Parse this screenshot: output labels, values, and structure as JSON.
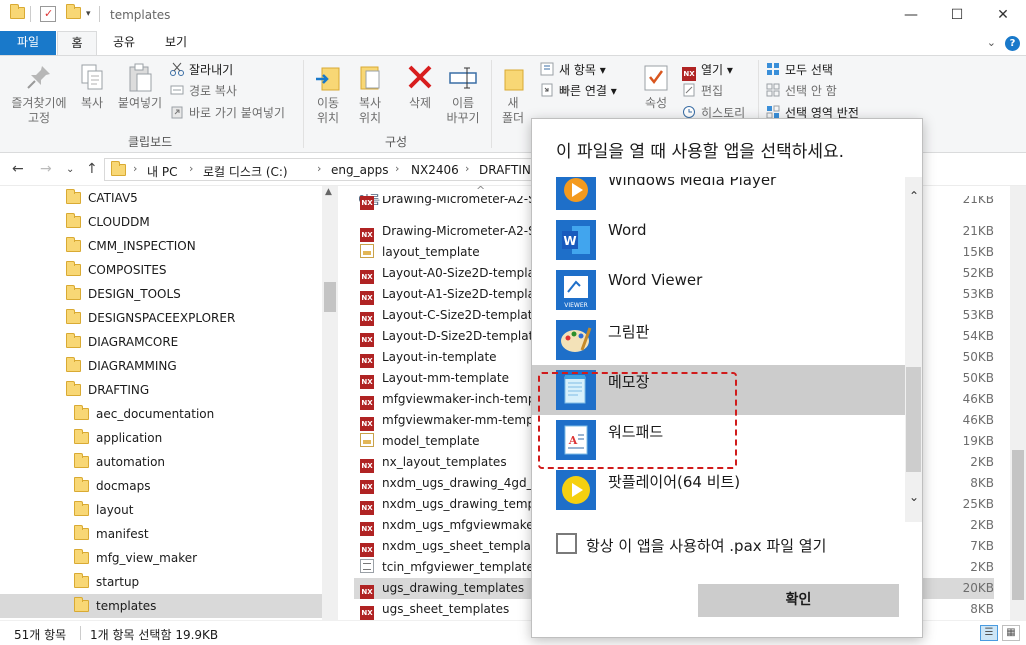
{
  "window": {
    "title": "templates",
    "minimize": "—",
    "maximize": "☐",
    "close": "✕",
    "accent": "#1979ca"
  },
  "tabs": {
    "file": "파일",
    "home": "홈",
    "share": "공유",
    "view": "보기",
    "help": "?"
  },
  "ribbon": {
    "clipboard": {
      "pin": "즐겨찾기에\n고정",
      "copy": "복사",
      "paste": "붙여넣기",
      "cut": "잘라내기",
      "copy_path": "경로 복사",
      "paste_shortcut": "바로 가기 붙여넣기",
      "group": "클립보드"
    },
    "organize": {
      "move_to": "이동\n위치",
      "copy_to": "복사\n위치",
      "delete": "삭제",
      "rename": "이름\n바꾸기",
      "group": "구성"
    },
    "new": {
      "new_folder": "새\n폴더",
      "new_item": "새 항목",
      "easy_access": "빠른 연결"
    },
    "open": {
      "properties": "속성",
      "open": "열기",
      "edit": "편집",
      "history": "히스토리"
    },
    "select": {
      "select_all": "모두 선택",
      "select_none": "선택 안 함",
      "invert": "선택 영역 반전"
    }
  },
  "address": {
    "crumbs": [
      "내 PC",
      "로컬 디스크 (C:)",
      "eng_apps",
      "NX2406",
      "DRAFTING"
    ]
  },
  "nav": {
    "items": [
      {
        "label": "CATIAV5",
        "indent": 0
      },
      {
        "label": "CLOUDDM",
        "indent": 0
      },
      {
        "label": "CMM_INSPECTION",
        "indent": 0
      },
      {
        "label": "COMPOSITES",
        "indent": 0
      },
      {
        "label": "DESIGN_TOOLS",
        "indent": 0
      },
      {
        "label": "DESIGNSPACEEXPLORER",
        "indent": 0
      },
      {
        "label": "DIAGRAMCORE",
        "indent": 0
      },
      {
        "label": "DIAGRAMMING",
        "indent": 0
      },
      {
        "label": "DRAFTING",
        "indent": 0
      },
      {
        "label": "aec_documentation",
        "indent": 1
      },
      {
        "label": "application",
        "indent": 1
      },
      {
        "label": "automation",
        "indent": 1
      },
      {
        "label": "docmaps",
        "indent": 1
      },
      {
        "label": "layout",
        "indent": 1
      },
      {
        "label": "manifest",
        "indent": 1
      },
      {
        "label": "mfg_view_maker",
        "indent": 1
      },
      {
        "label": "startup",
        "indent": 1
      },
      {
        "label": "templates",
        "indent": 1,
        "selected": true
      }
    ]
  },
  "filelist": {
    "column_name": "이름",
    "rows": [
      {
        "name": "Drawing-Micrometer-A2-Siz",
        "type": "nx",
        "size": "21KB"
      },
      {
        "name": "Drawing-Micrometer-A2-Size",
        "type": "nx",
        "size": "21KB"
      },
      {
        "name": "layout_template",
        "type": "jpg",
        "size": "15KB"
      },
      {
        "name": "Layout-A0-Size2D-template",
        "type": "nx",
        "size": "52KB"
      },
      {
        "name": "Layout-A1-Size2D-template",
        "type": "nx",
        "size": "53KB"
      },
      {
        "name": "Layout-C-Size2D-template",
        "type": "nx",
        "size": "53KB"
      },
      {
        "name": "Layout-D-Size2D-template",
        "type": "nx",
        "size": "54KB"
      },
      {
        "name": "Layout-in-template",
        "type": "nx",
        "size": "50KB"
      },
      {
        "name": "Layout-mm-template",
        "type": "nx",
        "size": "50KB"
      },
      {
        "name": "mfgviewmaker-inch-templat",
        "type": "nx",
        "size": "46KB"
      },
      {
        "name": "mfgviewmaker-mm-templat",
        "type": "nx",
        "size": "46KB"
      },
      {
        "name": "model_template",
        "type": "jpg",
        "size": "19KB"
      },
      {
        "name": "nx_layout_templates",
        "type": "nx",
        "size": "2KB"
      },
      {
        "name": "nxdm_ugs_drawing_4gd_tem",
        "type": "nx",
        "size": "8KB"
      },
      {
        "name": "nxdm_ugs_drawing_template",
        "type": "nx",
        "size": "25KB"
      },
      {
        "name": "nxdm_ugs_mfgviewmaker_4",
        "type": "nx",
        "size": "2KB"
      },
      {
        "name": "nxdm_ugs_sheet_templates",
        "type": "nx",
        "size": "7KB"
      },
      {
        "name": "tcin_mfgviewer_template_set",
        "type": "txt",
        "size": "2KB"
      },
      {
        "name": "ugs_drawing_templates",
        "type": "nx",
        "size": "20KB",
        "selected": true
      },
      {
        "name": "ugs_sheet_templates",
        "type": "nx",
        "size": "8KB"
      }
    ]
  },
  "status": {
    "count": "51개 항목",
    "selected": "1개 항목 선택함 19.9KB"
  },
  "dialog": {
    "title": "이 파일을 열 때 사용할 앱을 선택하세요.",
    "apps": [
      {
        "name": "Windows Media Player",
        "icon": "media-player-icon"
      },
      {
        "name": "Word",
        "icon": "word-icon"
      },
      {
        "name": "Word Viewer",
        "icon": "word-viewer-icon"
      },
      {
        "name": "그림판",
        "icon": "paint-icon"
      },
      {
        "name": "메모장",
        "icon": "notepad-icon",
        "highlighted": true
      },
      {
        "name": "워드패드",
        "icon": "wordpad-icon"
      },
      {
        "name": "팟플레이어(64 비트)",
        "icon": "potplayer-icon"
      }
    ],
    "always_use": "항상 이 앱을 사용하여 .pax 파일 열기",
    "always_checked": false,
    "ok": "확인",
    "annotation_color": "#d01b1b"
  }
}
